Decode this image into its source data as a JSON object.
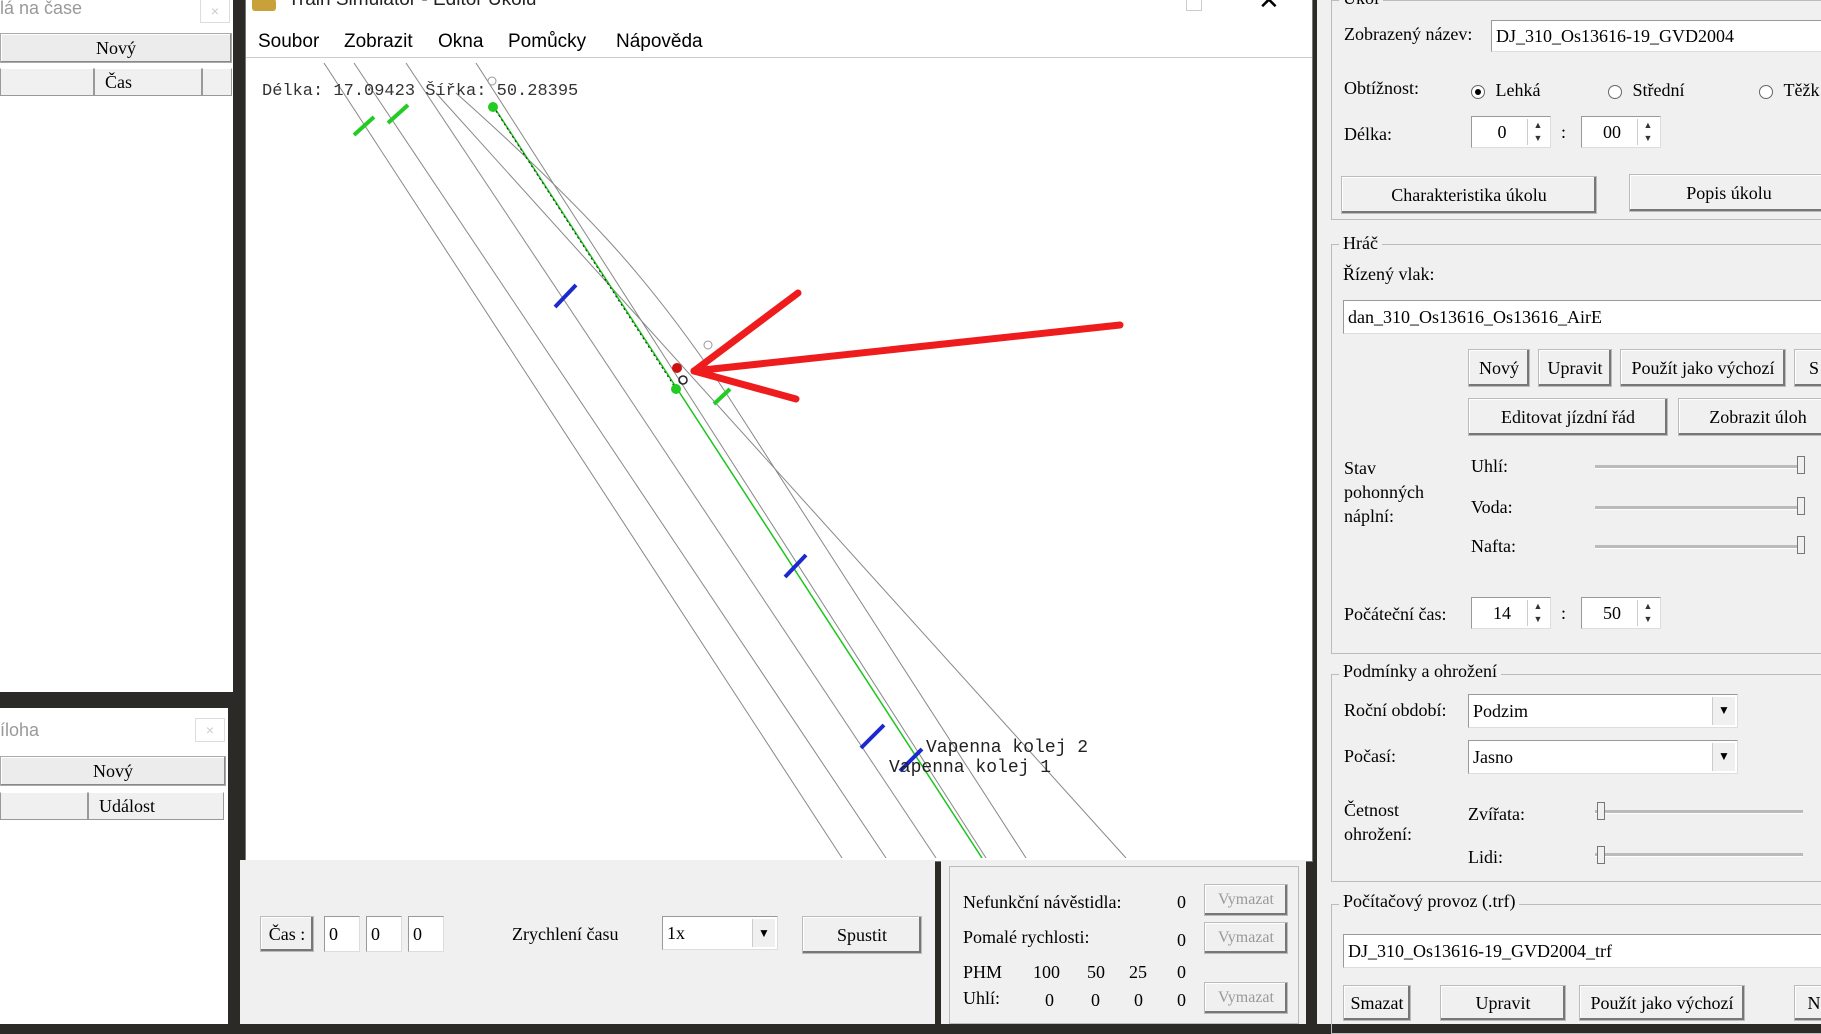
{
  "left_top": {
    "title": "lá na čase",
    "new_button": "Nový",
    "col_time": "Čas"
  },
  "left_bottom": {
    "title": "íloha",
    "new_button": "Nový",
    "col_event": "Událost"
  },
  "editor": {
    "title": "Train Simulator - Editor Úkolu",
    "menu": [
      "Soubor",
      "Zobrazit",
      "Okna",
      "Pomůcky",
      "Nápověda"
    ],
    "coords": "Délka: 17.09423 Šířka: 50.28395",
    "track_label_1": "Vapenna kolej 2",
    "track_label_2": "Vapenna kolej 1"
  },
  "time_panel": {
    "time_label": "Čas :",
    "h": "0",
    "m": "0",
    "s": "0",
    "accel_label": "Zrychlení času",
    "accel_value": "1x",
    "run_button": "Spustit"
  },
  "faults_panel": {
    "rows": [
      {
        "label": "Nefunkční návěstidla:",
        "value": "0",
        "button": "Vymazat"
      },
      {
        "label": "Pomalé rychlosti:",
        "value": "0",
        "button": "Vymazat"
      }
    ],
    "phm_label": "PHM",
    "phm_headers": [
      "100",
      "50",
      "25",
      "0"
    ],
    "coal_label": "Uhlí:",
    "coal_values": [
      "0",
      "0",
      "0",
      "0"
    ],
    "coal_button": "Vymazat"
  },
  "right": {
    "ukol_group": "Úkol",
    "display_name_label": "Zobrazený název:",
    "display_name": "DJ_310_Os13616-19_GVD2004",
    "difficulty_label": "Obtížnost:",
    "difficulty_options": [
      "Lehká",
      "Střední",
      "Těžk"
    ],
    "length_label": "Délka:",
    "length_h": "0",
    "length_m": "00",
    "colon": ":",
    "char_button": "Charakteristika úkolu",
    "desc_button": "Popis úkolu",
    "player_group": "Hráč",
    "train_label": "Řízený vlak:",
    "train_value": "dan_310_Os13616_Os13616_AirE",
    "btn_new": "Nový",
    "btn_edit": "Upravit",
    "btn_default": "Použít jako výchozí",
    "btn_s": "S",
    "btn_timetable": "Editovat jízdní řád",
    "btn_show": "Zobrazit úloh",
    "fuel_label_1": "Stav",
    "fuel_label_2": "pohonných",
    "fuel_label_3": "náplní:",
    "coal": "Uhlí:",
    "water": "Voda:",
    "diesel": "Nafta:",
    "start_label": "Počáteční čas:",
    "start_h": "14",
    "start_m": "50",
    "cond_group": "Podmínky a ohrožení",
    "season_label": "Roční období:",
    "season_value": "Podzim",
    "weather_label": "Počasí:",
    "weather_value": "Jasno",
    "threat_label_1": "Četnost",
    "threat_label_2": "ohrožení:",
    "animals": "Zvířata:",
    "people": "Lidi:",
    "traffic_group": "Počítačový provoz (.trf)",
    "traffic_value": "DJ_310_Os13616-19_GVD2004_trf",
    "btn_delete": "Smazat",
    "btn_edit2": "Upravit",
    "btn_default2": "Použít jako výchozí",
    "btn_n": "N"
  }
}
